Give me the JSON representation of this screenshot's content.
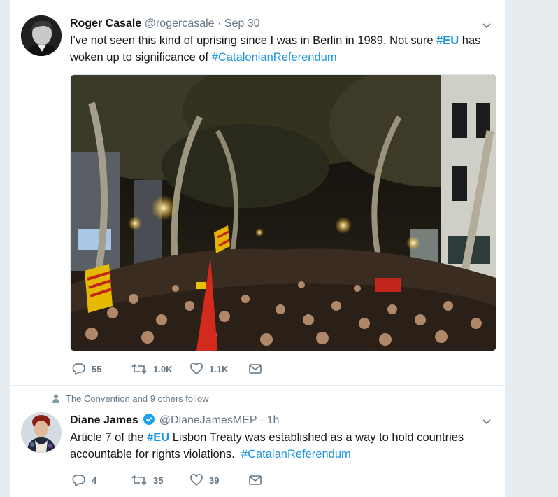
{
  "tweets": [
    {
      "author_name": "Roger Casale",
      "handle": "@rogercasale",
      "separator": "·",
      "time": "Sep 30",
      "text_parts": [
        "I've not seen this kind of uprising since I was in Berlin in 1989. Not sure ",
        "#EU",
        " has woken up to significance of ",
        "#CatalonianReferendum"
      ],
      "replies": "55",
      "retweets": "1.0K",
      "likes": "1.1K"
    },
    {
      "social_context": "The Convention and 9 others follow",
      "author_name": "Diane James",
      "verified": true,
      "handle": "@DianeJamesMEP",
      "separator": "·",
      "time": "1h",
      "text_parts": [
        "Article 7 of the ",
        "#EU",
        " Lisbon Treaty was established as a way to hold countries accountable for rights violations.  ",
        "#CatalanReferendum"
      ],
      "replies": "4",
      "retweets": "35",
      "likes": "39"
    }
  ],
  "colors": {
    "link": "#1b95e0",
    "muted": "#657786",
    "verified": "#1da1f2",
    "background": "#e6ecf0"
  },
  "icons": [
    "caret-down-icon",
    "reply-icon",
    "retweet-icon",
    "like-icon",
    "message-icon",
    "person-icon",
    "verified-icon"
  ]
}
